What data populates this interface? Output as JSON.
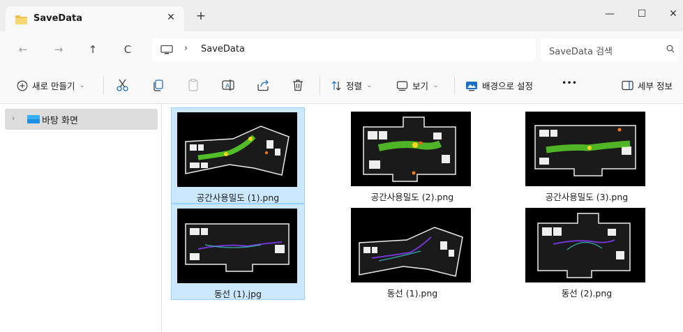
{
  "window": {
    "tab_title": "SaveData",
    "tab_close": "✕",
    "new_tab": "+",
    "minimize": "—",
    "maximize": "☐",
    "close": "✕"
  },
  "nav": {
    "back": "←",
    "forward": "→",
    "up": "↑",
    "refresh": "C",
    "breadcrumb_sep": "›",
    "breadcrumb": "SaveData",
    "search_placeholder": "SaveData 검색"
  },
  "commands": {
    "new": "새로 만들기",
    "sort": "정렬",
    "view": "보기",
    "set_background": "배경으로 설정",
    "more": "•••",
    "details": "세부 정보",
    "caret": "⌄"
  },
  "sidebar": {
    "items": [
      {
        "expander": "›",
        "label": "바탕 화면"
      }
    ]
  },
  "files": [
    {
      "name": "공간사용밀도 (1).png",
      "selected": true
    },
    {
      "name": "공간사용밀도 (2).png",
      "selected": false
    },
    {
      "name": "공간사용밀도 (3).png",
      "selected": false
    },
    {
      "name": "동선 (1).jpg",
      "selected": true
    },
    {
      "name": "동선 (1).png",
      "selected": false
    },
    {
      "name": "동선 (2).png",
      "selected": false
    }
  ],
  "colors": {
    "selection_bg": "#cce8ff",
    "selection_border": "#99d1ff",
    "folder_yellow": "#f2c14e",
    "desktop_blue": "#1e8fe0"
  }
}
